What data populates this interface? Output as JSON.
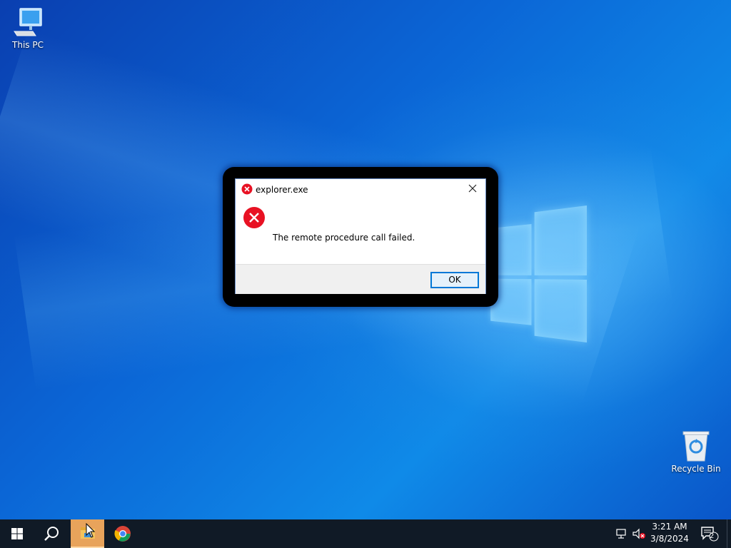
{
  "desktop": {
    "icons": [
      {
        "label": "This PC",
        "icon": "computer-icon"
      },
      {
        "label": "Recycle Bin",
        "icon": "recycle-bin-icon"
      }
    ]
  },
  "dialog": {
    "title": "explorer.exe",
    "message": "The remote procedure call failed.",
    "ok_label": "OK",
    "title_icon": "error-icon",
    "close_icon": "close-icon",
    "colors": {
      "error": "#e81123",
      "accent": "#0078d7"
    }
  },
  "taskbar": {
    "pinned": [
      {
        "name": "start",
        "icon": "windows-logo-icon"
      },
      {
        "name": "search",
        "icon": "search-icon"
      },
      {
        "name": "file-explorer",
        "icon": "folder-icon",
        "active": true
      },
      {
        "name": "chrome",
        "icon": "chrome-icon"
      }
    ],
    "tray": {
      "time": "3:21 AM",
      "date": "3/8/2024",
      "network_icon": "network-icon",
      "volume_icon": "volume-muted-icon",
      "notification_count": "2"
    }
  }
}
